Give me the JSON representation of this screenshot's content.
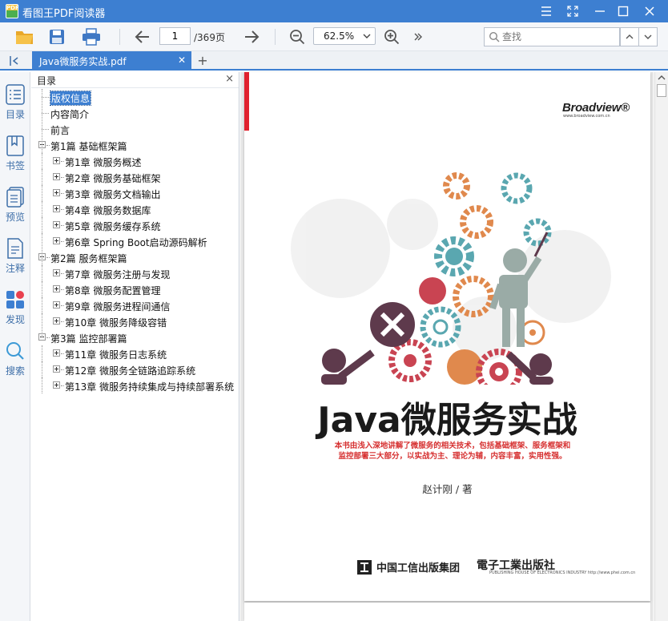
{
  "window": {
    "app_logo_text": "PDF",
    "title": "看图王PDF阅读器"
  },
  "toolbar": {
    "current_page": "1",
    "total_pages": "/369页",
    "zoom": "62.5%",
    "search_placeholder": "查找"
  },
  "tabs": [
    {
      "label": "Java微服务实战.pdf"
    }
  ],
  "rail": [
    {
      "label": "目录",
      "icon": "list-icon"
    },
    {
      "label": "书签",
      "icon": "bookmark-icon"
    },
    {
      "label": "预览",
      "icon": "pages-icon"
    },
    {
      "label": "注释",
      "icon": "note-icon"
    },
    {
      "label": "发现",
      "icon": "discover-icon"
    },
    {
      "label": "搜索",
      "icon": "search-icon"
    }
  ],
  "toc": {
    "title": "目录",
    "items": [
      {
        "label": "版权信息",
        "level": 0,
        "selected": true
      },
      {
        "label": "内容简介",
        "level": 0
      },
      {
        "label": "前言",
        "level": 0
      },
      {
        "label": "第1篇 基础框架篇",
        "level": 0,
        "expand": "minus"
      },
      {
        "label": "第1章 微服务概述",
        "level": 1,
        "expand": "plus"
      },
      {
        "label": "第2章 微服务基础框架",
        "level": 1,
        "expand": "plus"
      },
      {
        "label": "第3章 微服务文档输出",
        "level": 1,
        "expand": "plus"
      },
      {
        "label": "第4章 微服务数据库",
        "level": 1,
        "expand": "plus"
      },
      {
        "label": "第5章 微服务缓存系统",
        "level": 1,
        "expand": "plus"
      },
      {
        "label": "第6章 Spring Boot启动源码解析",
        "level": 1,
        "expand": "plus"
      },
      {
        "label": "第2篇 服务框架篇",
        "level": 0,
        "expand": "minus"
      },
      {
        "label": "第7章 微服务注册与发现",
        "level": 1,
        "expand": "plus"
      },
      {
        "label": "第8章 微服务配置管理",
        "level": 1,
        "expand": "plus"
      },
      {
        "label": "第9章 微服务进程间通信",
        "level": 1,
        "expand": "plus"
      },
      {
        "label": "第10章 微服务降级容错",
        "level": 1,
        "expand": "plus"
      },
      {
        "label": "第3篇 监控部署篇",
        "level": 0,
        "expand": "minus"
      },
      {
        "label": "第11章 微服务日志系统",
        "level": 1,
        "expand": "plus"
      },
      {
        "label": "第12章 微服务全链路追踪系统",
        "level": 1,
        "expand": "plus"
      },
      {
        "label": "第13章 微服务持续集成与持续部署系统",
        "level": 1,
        "expand": "plus"
      }
    ]
  },
  "cover": {
    "publisher_brand": "Broadview®",
    "publisher_url": "www.broadview.com.cn",
    "title": "Java微服务实战",
    "blurb_line1": "本书由浅入深地讲解了微服务的相关技术，包括基础框架、服务框架和",
    "blurb_line2": "监控部署三大部分，以实战为主、理论为辅，内容丰富，实用性强。",
    "author": "赵计刚 / 著",
    "publisher1": "中国工信出版集团",
    "publisher2": "電子工業出版社",
    "publisher2_sub": "PUBLISHING HOUSE OF ELECTRONICS INDUSTRY http://www.phei.com.cn"
  },
  "colors": {
    "accent": "#3d7fd1",
    "cover_red": "#e0212d",
    "gear_teal": "#5aa7b0",
    "gear_red": "#c94452",
    "gear_orange": "#e0894d",
    "figure_plum": "#5e3a4c",
    "figure_sage": "#9aaba6"
  }
}
